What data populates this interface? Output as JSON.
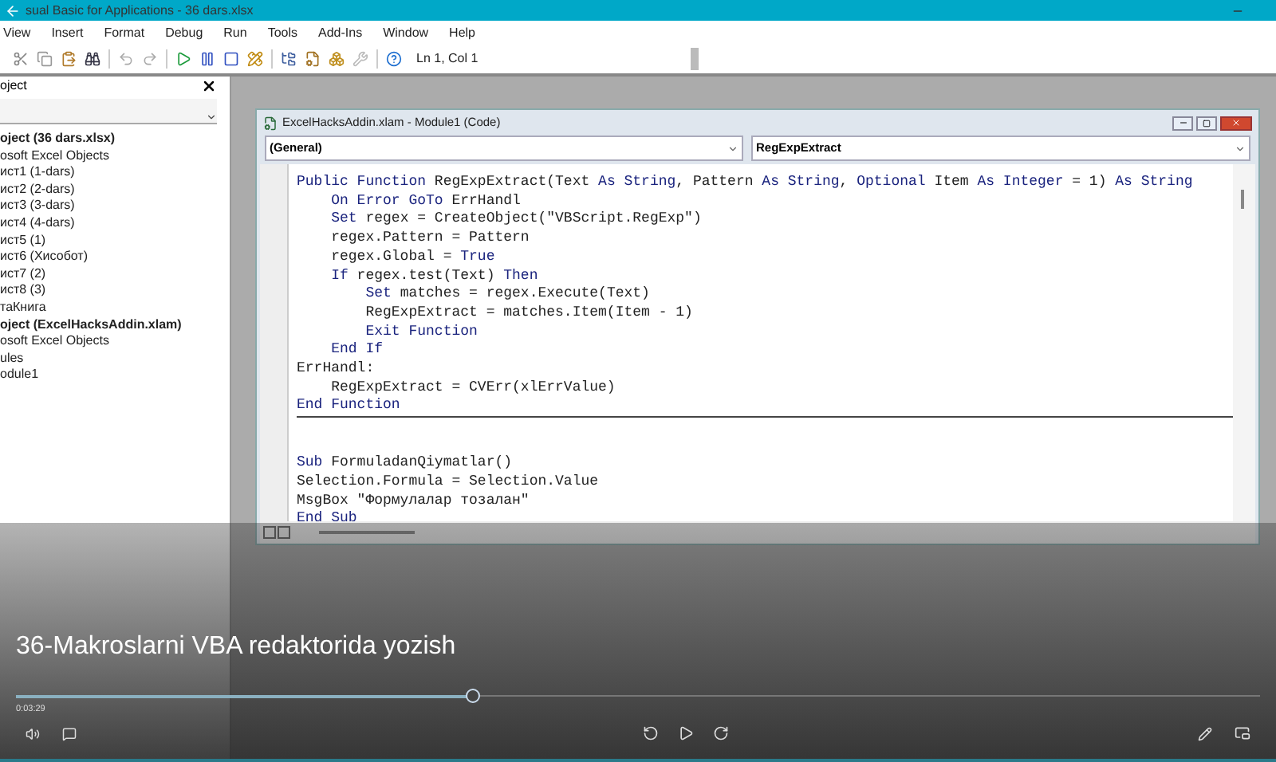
{
  "window": {
    "title": "sual Basic for Applications - 36 dars.xlsx"
  },
  "menu": [
    "View",
    "Insert",
    "Format",
    "Debug",
    "Run",
    "Tools",
    "Add-Ins",
    "Window",
    "Help"
  ],
  "toolbar": {
    "position": "Ln 1, Col 1"
  },
  "project_panel": {
    "title": "oject",
    "tree": [
      {
        "label": "oject (36 dars.xlsx)",
        "children": [
          {
            "label": "osoft Excel Objects",
            "children": [
              {
                "label": "ист1 (1-dars)"
              },
              {
                "label": "ист2 (2-dars)"
              },
              {
                "label": "ист3 (3-dars)"
              },
              {
                "label": "ист4 (4-dars)"
              },
              {
                "label": "ист5 (1)"
              },
              {
                "label": "ист6 (Хисобот)"
              },
              {
                "label": "ист7 (2)"
              },
              {
                "label": "ист8 (3)"
              },
              {
                "label": "таКнига"
              }
            ]
          }
        ]
      },
      {
        "label": "oject (ExcelHacksAddin.xlam)",
        "children": [
          {
            "label": "osoft Excel Objects"
          },
          {
            "label": "ules",
            "children": [
              {
                "label": "odule1"
              }
            ]
          }
        ]
      }
    ]
  },
  "code_window": {
    "title": "ExcelHacksAddin.xlam - Module1 (Code)",
    "object_combo": "(General)",
    "procedure_combo": "RegExpExtract",
    "procedures": [
      {
        "lines": [
          [
            {
              "kind": "keyword",
              "text": "Public Function "
            },
            {
              "kind": "text",
              "text": "RegExpExtract(Text "
            },
            {
              "kind": "keyword",
              "text": "As String"
            },
            {
              "kind": "text",
              "text": ", Pattern "
            },
            {
              "kind": "keyword",
              "text": "As String"
            },
            {
              "kind": "text",
              "text": ", "
            },
            {
              "kind": "keyword",
              "text": "Optional"
            },
            {
              "kind": "text",
              "text": " Item "
            },
            {
              "kind": "keyword",
              "text": "As Integer"
            },
            {
              "kind": "text",
              "text": " = 1) "
            },
            {
              "kind": "keyword",
              "text": "As String"
            }
          ],
          [
            {
              "kind": "keyword",
              "text": "    On Error GoTo"
            },
            {
              "kind": "text",
              "text": " ErrHandl"
            }
          ],
          [
            {
              "kind": "keyword",
              "text": "    Set"
            },
            {
              "kind": "text",
              "text": " regex = CreateObject(\"VBScript.RegExp\")"
            }
          ],
          [
            {
              "kind": "text",
              "text": "    regex.Pattern = Pattern"
            }
          ],
          [
            {
              "kind": "text",
              "text": "    regex.Global = "
            },
            {
              "kind": "keyword",
              "text": "True"
            }
          ],
          [
            {
              "kind": "keyword",
              "text": "    If"
            },
            {
              "kind": "text",
              "text": " regex.test(Text) "
            },
            {
              "kind": "keyword",
              "text": "Then"
            }
          ],
          [
            {
              "kind": "keyword",
              "text": "        Set"
            },
            {
              "kind": "text",
              "text": " matches = regex.Execute(Text)"
            }
          ],
          [
            {
              "kind": "text",
              "text": "        RegExpExtract = matches.Item(Item - 1)"
            }
          ],
          [
            {
              "kind": "keyword",
              "text": "        Exit Function"
            }
          ],
          [
            {
              "kind": "keyword",
              "text": "    End If"
            }
          ],
          [
            {
              "kind": "text",
              "text": "ErrHandl:"
            }
          ],
          [
            {
              "kind": "text",
              "text": "    RegExpExtract = CVErr(xlErrValue)"
            }
          ],
          [
            {
              "kind": "keyword",
              "text": "End Function"
            }
          ]
        ]
      },
      {
        "lines": [
          [
            {
              "kind": "keyword",
              "text": "Sub"
            },
            {
              "kind": "text",
              "text": " FormuladanQiymatlar()"
            }
          ],
          [
            {
              "kind": "text",
              "text": "Selection.Formula = Selection.Value"
            }
          ],
          [
            {
              "kind": "text",
              "text": "MsgBox \"Формулалар тозалан\""
            }
          ],
          [
            {
              "kind": "keyword",
              "text": "End Sub"
            }
          ]
        ]
      }
    ]
  },
  "player": {
    "title": "36-Makroslarni VBA redaktorida yozish",
    "time": "0:03:29",
    "level": 0.367
  }
}
